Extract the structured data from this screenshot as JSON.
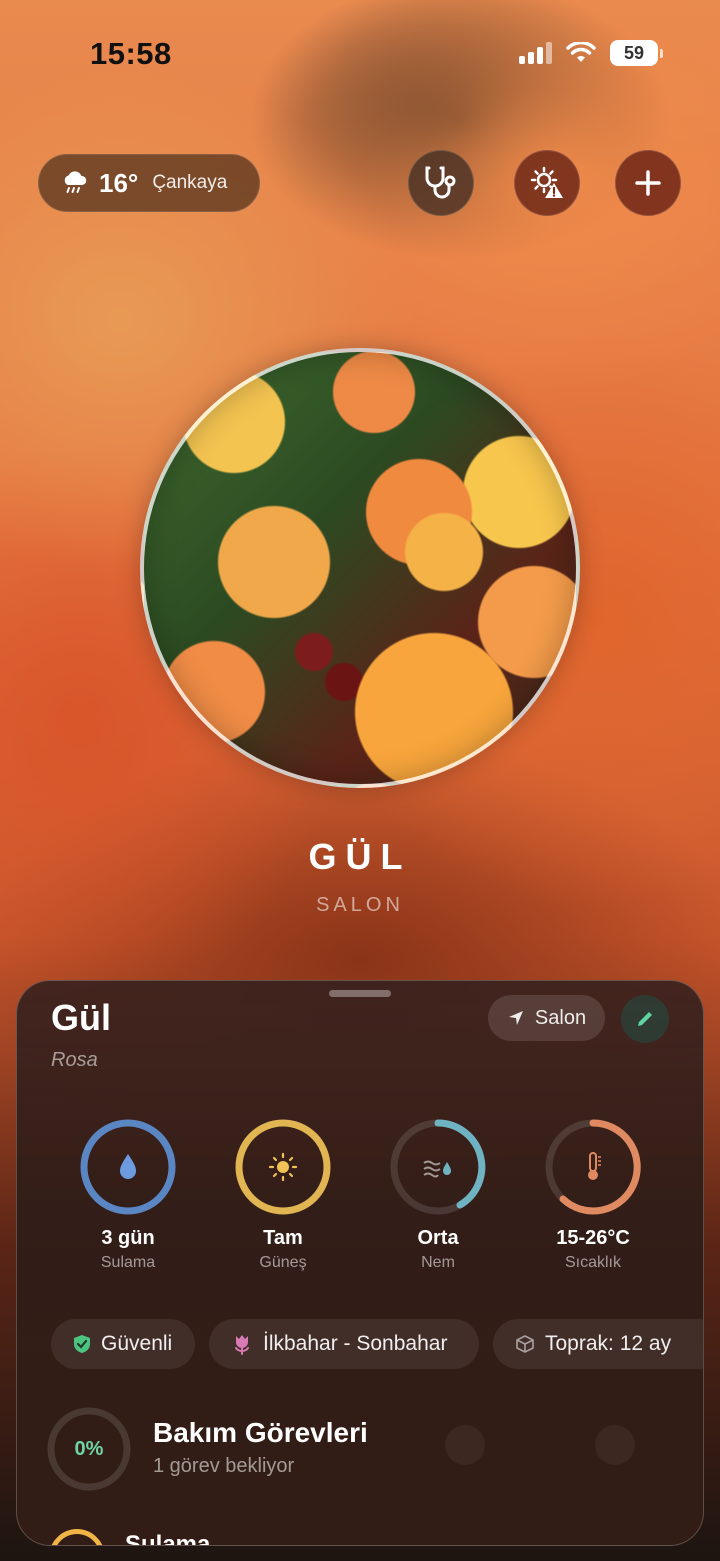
{
  "status_bar": {
    "time": "15:58",
    "battery": "59"
  },
  "weather": {
    "temp": "16°",
    "city": "Çankaya",
    "icon": "rain-cloud-icon"
  },
  "toolbar": {
    "diagnose_icon": "stethoscope-icon",
    "light_icon": "sun-warning-icon",
    "add_icon": "plus-icon"
  },
  "hero": {
    "title": "GÜL",
    "room": "SALON"
  },
  "sheet": {
    "name": "Gül",
    "latin": "Rosa",
    "location": "Salon",
    "metrics": [
      {
        "value": "3 gün",
        "label": "Sulama",
        "icon": "water-drop-icon",
        "color": "#5b86c4"
      },
      {
        "value": "Tam",
        "label": "Güneş",
        "icon": "sun-icon",
        "color": "#e0b552"
      },
      {
        "value": "Orta",
        "label": "Nem",
        "icon": "humidity-icon",
        "color": "#6fb3c2"
      },
      {
        "value": "15-26°C",
        "label": "Sıcaklık",
        "icon": "thermometer-icon",
        "color": "#e08a62"
      }
    ],
    "chips": [
      {
        "label": "Güvenli",
        "icon": "shield-check-icon"
      },
      {
        "label": "İlkbahar - Sonbahar",
        "icon": "tulip-icon"
      },
      {
        "label": "Toprak: 12 ay",
        "icon": "cube-icon"
      }
    ],
    "care": {
      "percent": "0%",
      "title": "Bakım Görevleri",
      "subtitle": "1 görev bekliyor"
    },
    "next_task": "Sulama"
  }
}
